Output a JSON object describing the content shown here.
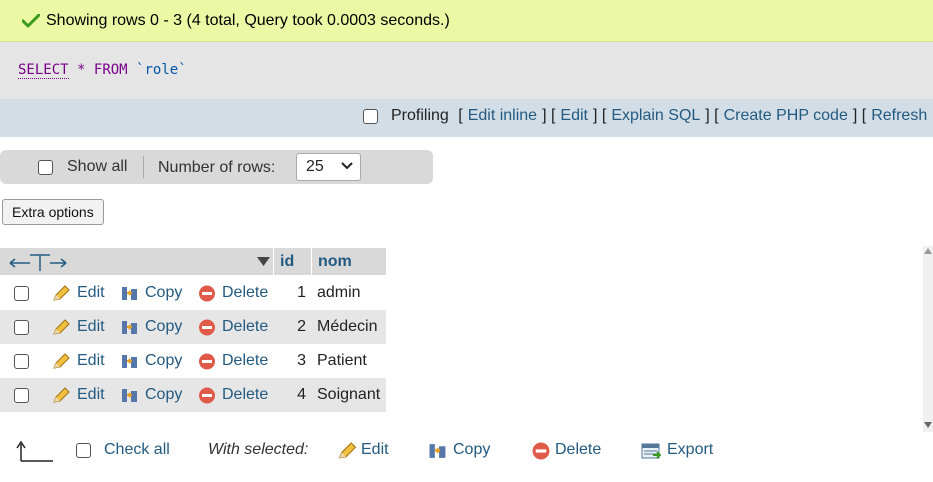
{
  "success": {
    "message": "Showing rows 0 - 3 (4 total, Query took 0.0003 seconds.)"
  },
  "sql": {
    "select": "SELECT",
    "star": "*",
    "from": "FROM",
    "table": "`role`"
  },
  "toolbar": {
    "profiling": "Profiling",
    "links": [
      "Edit inline",
      "Edit",
      "Explain SQL",
      "Create PHP code",
      "Refresh"
    ]
  },
  "navigation": {
    "show_all": "Show all",
    "number_of_rows_label": "Number of rows:",
    "number_of_rows_value": "25"
  },
  "extra_options": "Extra options",
  "table": {
    "columns": [
      "id",
      "nom"
    ],
    "actions": {
      "edit": "Edit",
      "copy": "Copy",
      "delete": "Delete"
    },
    "rows": [
      {
        "id": "1",
        "nom": "admin"
      },
      {
        "id": "2",
        "nom": "Médecin"
      },
      {
        "id": "3",
        "nom": "Patient"
      },
      {
        "id": "4",
        "nom": "Soignant"
      }
    ]
  },
  "bulk": {
    "check_all": "Check all",
    "with_selected": "With selected:",
    "edit": "Edit",
    "copy": "Copy",
    "delete": "Delete",
    "export": "Export"
  },
  "colors": {
    "success_bg": "#ebf8a4",
    "link": "#235a81",
    "toolbar_bg": "#d2dde6",
    "sql_bg": "#e5e5e5"
  }
}
